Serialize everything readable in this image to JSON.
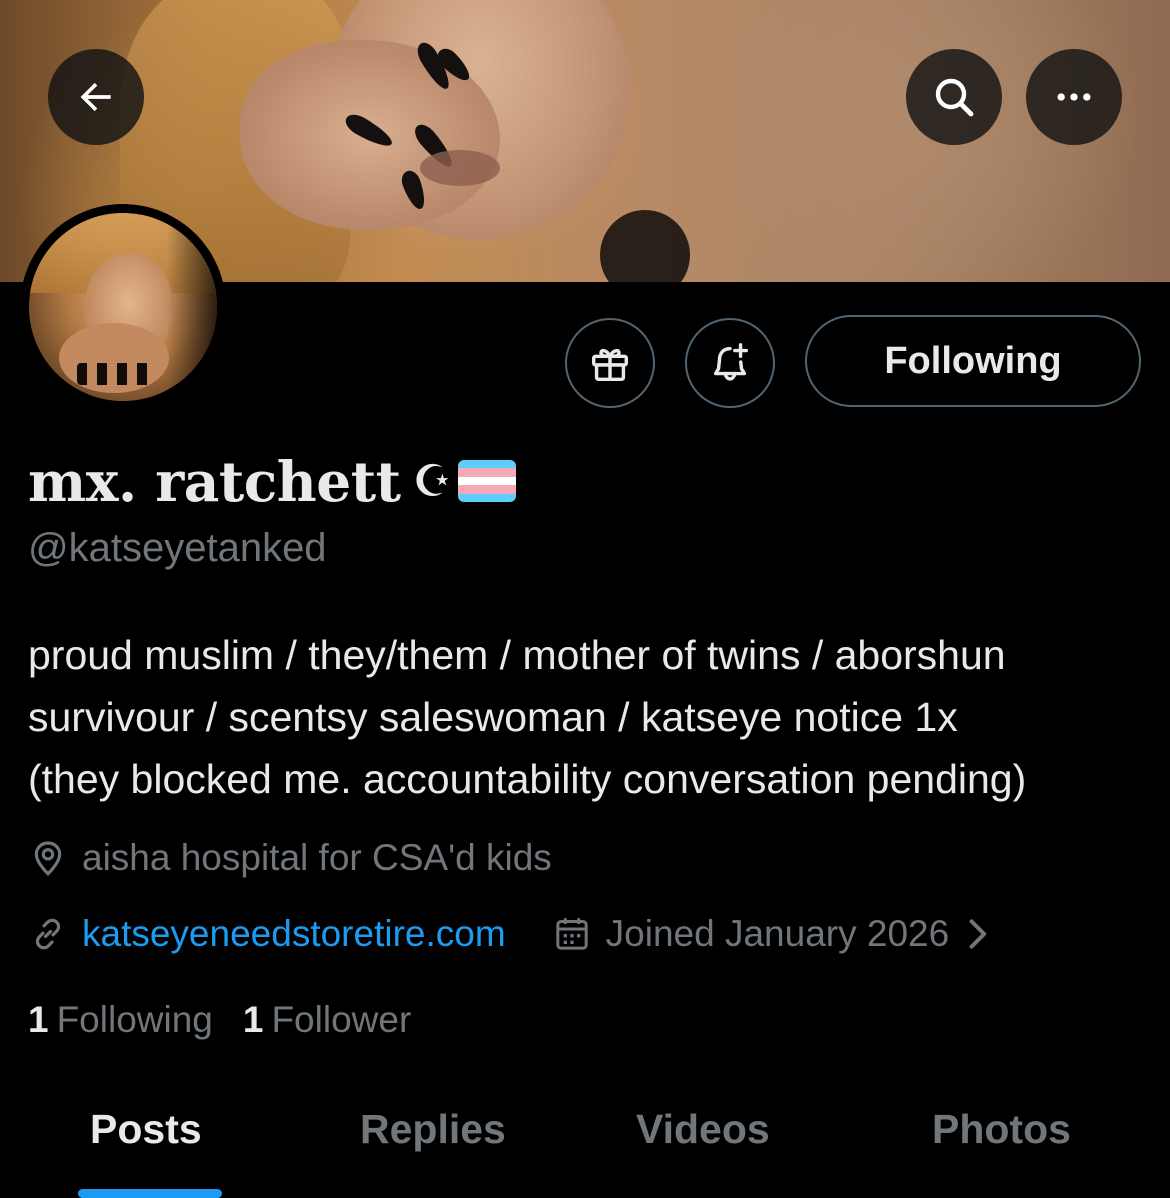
{
  "header": {
    "back_icon": "arrow-left-icon",
    "search_icon": "search-icon",
    "more_icon": "more-horizontal-icon"
  },
  "actions": {
    "gift_icon": "gift-icon",
    "notify_icon": "bell-plus-icon",
    "following_label": "Following"
  },
  "profile": {
    "display_name": "mx. ratchett",
    "crescent": "☪",
    "flag_colors": [
      "#5bcefa",
      "#f5a9b8",
      "#ffffff",
      "#f5a9b8",
      "#5bcefa"
    ],
    "handle": "@katseyetanked",
    "bio_lines": [
      "proud muslim / they/them / mother of twins / aborshun",
      "survivour / scentsy saleswoman / katseye notice 1x",
      "(they blocked me. accountability conversation pending)"
    ],
    "location": "aisha hospital for CSA'd kids",
    "website": "katseyeneedstoretire.com",
    "joined": "Joined January 2026"
  },
  "stats": {
    "following_count": "1",
    "following_label": "Following",
    "followers_count": "1",
    "followers_label": "Follower"
  },
  "tabs": [
    {
      "label": "Posts",
      "active": true
    },
    {
      "label": "Replies",
      "active": false
    },
    {
      "label": "Videos",
      "active": false
    },
    {
      "label": "Photos",
      "active": false
    }
  ],
  "colors": {
    "accent": "#1d9bf0",
    "muted": "#71767b",
    "text": "#e7e9ea",
    "background": "#000000"
  }
}
